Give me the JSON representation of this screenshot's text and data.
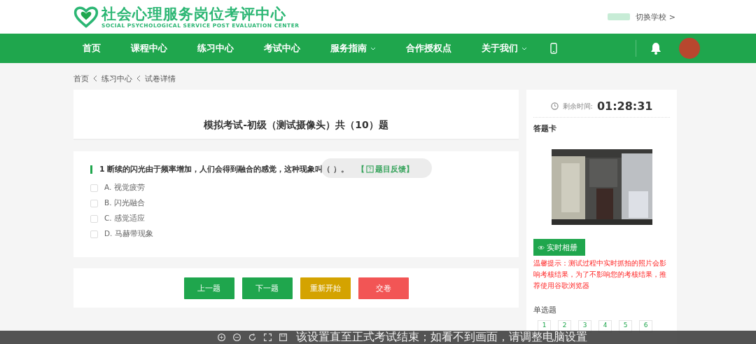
{
  "header": {
    "logo_title": "社会心理服务岗位考评中心",
    "logo_subtitle": "SOCIAL PSYCHOLOGICAL SERVICE POST EVALUATION CENTER",
    "switch_school": "切换学校 >"
  },
  "nav": [
    {
      "label": "首页",
      "dropdown": false
    },
    {
      "label": "课程中心",
      "dropdown": false
    },
    {
      "label": "练习中心",
      "dropdown": false
    },
    {
      "label": "考试中心",
      "dropdown": false
    },
    {
      "label": "服务指南",
      "dropdown": true
    },
    {
      "label": "合作授权点",
      "dropdown": false
    },
    {
      "label": "关于我们",
      "dropdown": true
    }
  ],
  "breadcrumb": [
    "首页",
    "练习中心",
    "试卷详情"
  ],
  "exam_title": "模拟考试-初级（测试摄像头）共（10）题",
  "question": {
    "number": "1",
    "text": "断续的闪光由于频率增加，人们会得到融合的感觉，这种现象叫（ ）。",
    "feedback": "【 ",
    "feedback_label": "题目反馈】",
    "options": [
      {
        "label": "A. 视觉疲劳",
        "checked": false
      },
      {
        "label": "B. 闪光融合",
        "checked": false
      },
      {
        "label": "C. 感觉适应",
        "checked": false
      },
      {
        "label": "D. 马赫带现象",
        "checked": false
      }
    ]
  },
  "buttons": [
    {
      "label": "上一题",
      "kind": "green"
    },
    {
      "label": "下一题",
      "kind": "green"
    },
    {
      "label": "重新开始",
      "kind": "gold"
    },
    {
      "label": "交卷",
      "kind": "red"
    }
  ],
  "sidebar": {
    "timer_label": "剩余时间:",
    "timer": "01:28:31",
    "card_title": "答题卡",
    "camera": {
      "kind": "picture"
    },
    "album_button": "实时相册",
    "warning": "温馨提示：测试过程中实时抓拍的照片会影响考核结果，为了不影响您的考核结果，推荐使用谷歌浏览器",
    "section": "单选题",
    "numbers": [
      "1",
      "2",
      "3",
      "4",
      "5",
      "6"
    ]
  },
  "subtitle": "该设置直至正式考试结束；如看不到画面，请调整电脑设置"
}
